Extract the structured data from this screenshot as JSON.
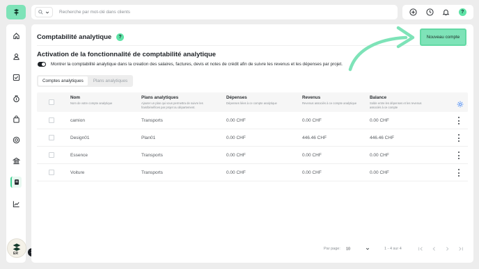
{
  "app": {
    "logo_icon": "brand-logo-icon",
    "accent": "#7ee3b8"
  },
  "search": {
    "placeholder": "Recherche par mot-clé dans clients"
  },
  "topbar_icons": [
    "add-circle-icon",
    "clock-icon",
    "bell-icon",
    "help-icon"
  ],
  "help_label": "?",
  "sidebar": {
    "items": [
      "home-icon",
      "contacts-icon",
      "tasks-icon",
      "money-bag-icon",
      "shopping-bag-icon",
      "support-icon",
      "bank-icon",
      "accounting-book-icon",
      "chart-icon"
    ],
    "active": "accounting-book-icon"
  },
  "user": {
    "initials": "ER",
    "badge": "2"
  },
  "page": {
    "title": "Comptabilité analytique",
    "new_button": "Nouveau compte",
    "section_title": "Activation de la fonctionnalité de comptabilité analytique",
    "toggle_label": "Montrer la comptabilité analytique dans la creation des salaires, factures, devis et notes de crédit afin de suivre les revenus et les dépenses par projet."
  },
  "tabs": [
    {
      "label": "Comptes analytiques",
      "active": true
    },
    {
      "label": "Plans analytiques",
      "active": false
    }
  ],
  "table": {
    "columns": [
      {
        "title": "Nom",
        "sub": "Nom de votre compte analytique"
      },
      {
        "title": "Plans analytiques",
        "sub": "Ajouter un plan qui vous permettra de suivre les frais/bénéfices par projet ou département."
      },
      {
        "title": "Dépenses",
        "sub": "Dépenses liées à ce compte analytique"
      },
      {
        "title": "Revenus",
        "sub": "Revenus associés à ce compte analytique"
      },
      {
        "title": "Balance",
        "sub": "Solde entre les dépenses et les revenus associés à ce compte"
      }
    ],
    "rows": [
      {
        "name": "camion",
        "plan": "Transports",
        "depenses": "0.00 CHF",
        "revenus": "0.00 CHF",
        "balance": "0.00 CHF"
      },
      {
        "name": "Design01",
        "plan": "Plan01",
        "depenses": "0.00 CHF",
        "revenus": "446.46 CHF",
        "balance": "446.46 CHF"
      },
      {
        "name": "Essence",
        "plan": "Transports",
        "depenses": "0.00 CHF",
        "revenus": "0.00 CHF",
        "balance": "0.00 CHF"
      },
      {
        "name": "Voiture",
        "plan": "Transports",
        "depenses": "0.00 CHF",
        "revenus": "0.00 CHF",
        "balance": "0.00 CHF"
      }
    ]
  },
  "pagination": {
    "per_page_label": "Par page:",
    "per_page_value": "10",
    "range": "1 - 4 sur 4"
  }
}
